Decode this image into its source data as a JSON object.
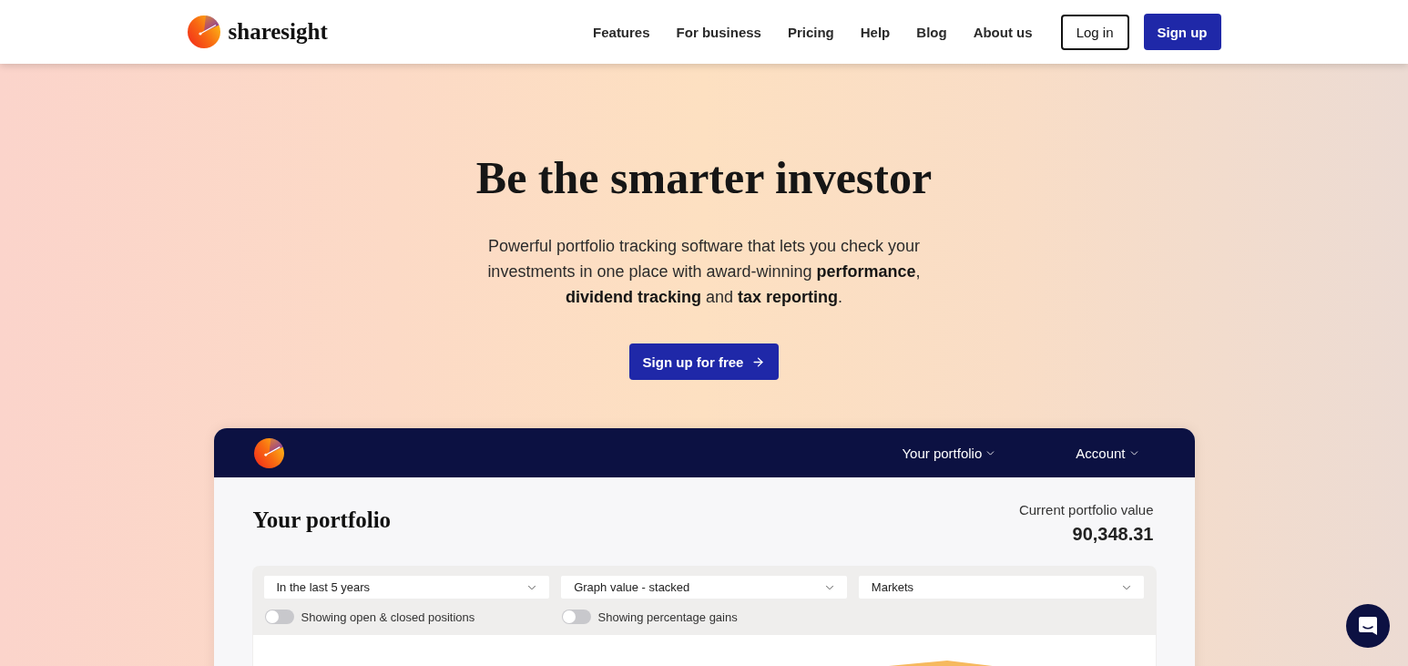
{
  "header": {
    "brand": "sharesight",
    "nav": [
      {
        "label": "Features"
      },
      {
        "label": "For business"
      },
      {
        "label": "Pricing"
      },
      {
        "label": "Help"
      },
      {
        "label": "Blog"
      },
      {
        "label": "About us"
      }
    ],
    "login": "Log in",
    "signup": "Sign up"
  },
  "hero": {
    "title": "Be the smarter investor",
    "text": "Powerful portfolio tracking software that lets you check your investments in one place with award-winning **performance**, **dividend tracking** and **tax reporting**.",
    "cta": "Sign up for free"
  },
  "app_preview": {
    "menus": [
      {
        "label": "Your portfolio"
      },
      {
        "label": "Account"
      }
    ],
    "title": "Your portfolio",
    "value_label": "Current portfolio value",
    "value": "90,348.31",
    "selects": [
      {
        "value": "In the last 5 years"
      },
      {
        "value": "Graph value - stacked"
      },
      {
        "value": "Markets"
      }
    ],
    "toggles": [
      {
        "label": "Showing open & closed positions",
        "on": false
      },
      {
        "label": "Showing percentage gains",
        "on": false
      }
    ]
  }
}
